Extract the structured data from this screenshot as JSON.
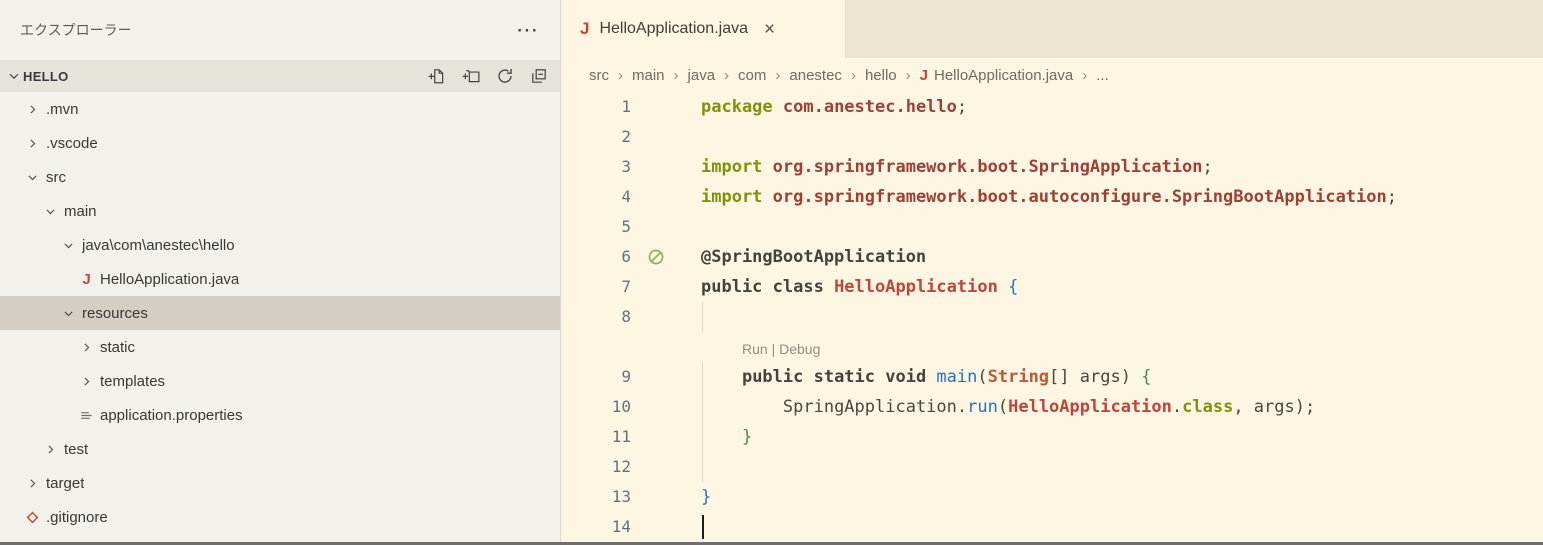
{
  "explorer": {
    "title": "エクスプローラー",
    "more_label": "⋯",
    "section": {
      "name": "HELLO"
    },
    "actions": [
      {
        "name": "new-file"
      },
      {
        "name": "new-folder"
      },
      {
        "name": "refresh"
      },
      {
        "name": "collapse-all"
      }
    ],
    "tree": [
      {
        "label": ".mvn",
        "indent": 1,
        "chevron": "right"
      },
      {
        "label": ".vscode",
        "indent": 1,
        "chevron": "right"
      },
      {
        "label": "src",
        "indent": 1,
        "chevron": "down"
      },
      {
        "label": "main",
        "indent": 2,
        "chevron": "down"
      },
      {
        "label": "java\\com\\anestec\\hello",
        "indent": 3,
        "chevron": "down"
      },
      {
        "label": "HelloApplication.java",
        "indent": 4,
        "icon": "java"
      },
      {
        "label": "resources",
        "indent": 3,
        "chevron": "down",
        "selected": true
      },
      {
        "label": "static",
        "indent": 4,
        "chevron": "right"
      },
      {
        "label": "templates",
        "indent": 4,
        "chevron": "right"
      },
      {
        "label": "application.properties",
        "indent": 4,
        "icon": "properties"
      },
      {
        "label": "test",
        "indent": 2,
        "chevron": "right"
      },
      {
        "label": "target",
        "indent": 1,
        "chevron": "right"
      },
      {
        "label": ".gitignore",
        "indent": 1,
        "icon": "git"
      }
    ]
  },
  "editor": {
    "tab": {
      "icon": "java",
      "icon_text": "J",
      "label": "HelloApplication.java",
      "close": "×"
    },
    "breadcrumb": {
      "separator": "›",
      "items": [
        {
          "label": "src"
        },
        {
          "label": "main"
        },
        {
          "label": "java"
        },
        {
          "label": "com"
        },
        {
          "label": "anestec"
        },
        {
          "label": "hello"
        },
        {
          "label": "HelloApplication.java",
          "icon": "java"
        },
        {
          "label": "..."
        }
      ]
    },
    "codelens": "Run | Debug",
    "lines": [
      {
        "n": 1,
        "tokens": [
          [
            "package ",
            "kw"
          ],
          [
            "com.anestec.hello",
            "pkg"
          ],
          [
            ";",
            "def"
          ]
        ]
      },
      {
        "n": 2,
        "tokens": []
      },
      {
        "n": 3,
        "tokens": [
          [
            "import ",
            "kw"
          ],
          [
            "org.springframework.boot.SpringApplication",
            "pkg"
          ],
          [
            ";",
            "def"
          ]
        ]
      },
      {
        "n": 4,
        "tokens": [
          [
            "import ",
            "kw"
          ],
          [
            "org.springframework.boot.autoconfigure.SpringBootApplication",
            "pkg"
          ],
          [
            ";",
            "def"
          ]
        ]
      },
      {
        "n": 5,
        "tokens": []
      },
      {
        "n": 6,
        "glyph": true,
        "tokens": [
          [
            "@SpringBootApplication",
            "ann"
          ]
        ]
      },
      {
        "n": 7,
        "tokens": [
          [
            "public class ",
            "mod"
          ],
          [
            "HelloApplication",
            "cls"
          ],
          [
            " ",
            "def"
          ],
          [
            "{",
            "b1"
          ]
        ]
      },
      {
        "n": 8,
        "guide": true,
        "tokens": []
      },
      {
        "lens": true
      },
      {
        "n": 9,
        "guide": true,
        "tokens": [
          [
            "    ",
            "def"
          ],
          [
            "public static void ",
            "mod"
          ],
          [
            "main",
            "fn"
          ],
          [
            "(",
            "def"
          ],
          [
            "String",
            "typ"
          ],
          [
            "[] ",
            "def"
          ],
          [
            "args",
            "def"
          ],
          [
            ") ",
            "def"
          ],
          [
            "{",
            "b2"
          ]
        ]
      },
      {
        "n": 10,
        "guide": true,
        "tokens": [
          [
            "        ",
            "def"
          ],
          [
            "SpringApplication",
            "def"
          ],
          [
            ".",
            "def"
          ],
          [
            "run",
            "fn"
          ],
          [
            "(",
            "def"
          ],
          [
            "HelloApplication",
            "cls"
          ],
          [
            ".",
            "def"
          ],
          [
            "class",
            "kw"
          ],
          [
            ", ",
            "def"
          ],
          [
            "args",
            "def"
          ],
          [
            ");",
            "def"
          ]
        ]
      },
      {
        "n": 11,
        "guide": true,
        "tokens": [
          [
            "    ",
            "def"
          ],
          [
            "}",
            "b2"
          ]
        ]
      },
      {
        "n": 12,
        "guide": true,
        "tokens": []
      },
      {
        "n": 13,
        "tokens": [
          [
            "}",
            "b1"
          ]
        ]
      },
      {
        "n": 14,
        "cursor": true,
        "tokens": []
      }
    ]
  },
  "colors": {
    "editor_background": "#FDF6E3",
    "sidebar_background": "#F3F1EB",
    "tabbar_background": "#ECE5D1",
    "selection_background": "#D3CFC5",
    "java_icon": "#C4443C",
    "git_icon": "#C45137",
    "keyword_green": "#7D9408",
    "type_red": "#BE4539",
    "function_blue": "#2471C8"
  }
}
